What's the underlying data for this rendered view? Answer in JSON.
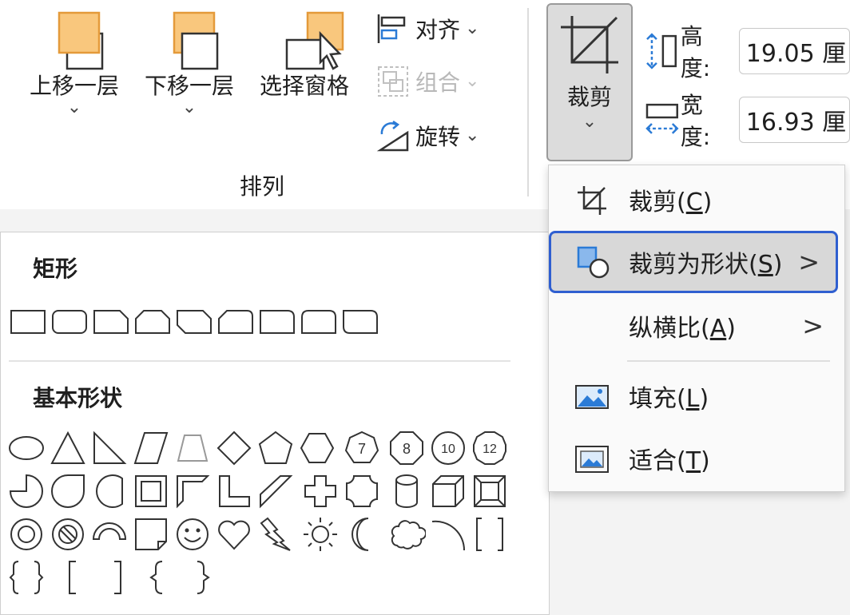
{
  "ribbon": {
    "bring_forward": {
      "label": "上移一层"
    },
    "send_backward": {
      "label": "下移一层"
    },
    "selection_pane": {
      "label": "选择窗格"
    },
    "align": {
      "label": "对齐"
    },
    "group": {
      "label": "组合"
    },
    "rotate": {
      "label": "旋转"
    },
    "arrange_group_label": "排列",
    "crop": {
      "label": "裁剪"
    },
    "height": {
      "label": "高度:",
      "value": "19.05 厘"
    },
    "width": {
      "label": "宽度:",
      "value": "16.93 厘"
    }
  },
  "crop_menu": {
    "items": [
      {
        "pre": "裁剪(",
        "key": "C",
        "post": ")",
        "icon": "crop-icon"
      },
      {
        "pre": "裁剪为形状(",
        "key": "S",
        "post": ")",
        "icon": "crop-to-shape-icon",
        "submenu": true,
        "highlighted": true
      },
      {
        "pre": "纵横比(",
        "key": "A",
        "post": ")",
        "icon": "",
        "submenu": true
      },
      {
        "pre": "填充(",
        "key": "L",
        "post": ")",
        "icon": "fill-picture-icon"
      },
      {
        "pre": "适合(",
        "key": "T",
        "post": ")",
        "icon": "fit-picture-icon"
      }
    ],
    "submenu_arrow": ">"
  },
  "gallery": {
    "rectangles_title": "矩形",
    "basic_shapes_title": "基本形状",
    "octagon_labels": [
      "7",
      "8",
      "10",
      "12"
    ]
  },
  "colors": {
    "accent_orange": "#f9c77d",
    "highlight_border": "#2f5fd0",
    "icon_blue": "#2b7bd6"
  }
}
